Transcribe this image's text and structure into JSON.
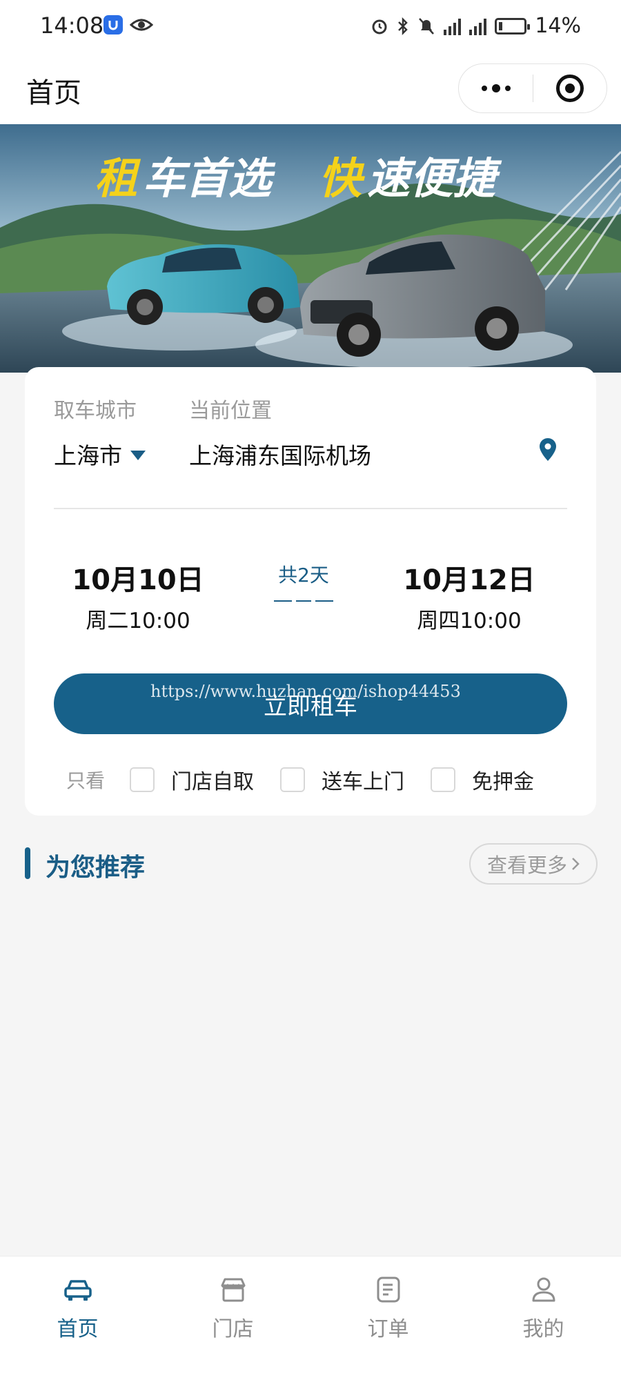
{
  "status_bar": {
    "time": "14:08",
    "battery": "14%",
    "battery_fraction": 0.14
  },
  "nav": {
    "title": "首页",
    "more_icon": "more-dots-icon",
    "close_icon": "target-icon"
  },
  "banner": {
    "headline_part1": "租",
    "headline_part2": "车首选",
    "headline_part3": "快",
    "headline_part4": "速便捷"
  },
  "booking": {
    "city_label": "取车城市",
    "city_value": "上海市",
    "location_label": "当前位置",
    "location_value": "上海浦东国际机场",
    "pickup_date": "10月10日",
    "pickup_time": "周二10:00",
    "duration": "共2天",
    "return_date": "10月12日",
    "return_time": "周四10:00",
    "rent_button": "立即租车",
    "watermark": "https://www.huzhan.com/ishop44453"
  },
  "filters": {
    "label": "只看",
    "options": [
      {
        "label": "门店自取",
        "checked": false
      },
      {
        "label": "送车上门",
        "checked": false
      },
      {
        "label": "免押金",
        "checked": false
      }
    ]
  },
  "recommend": {
    "title": "为您推荐",
    "more": "查看更多"
  },
  "tabs": [
    {
      "label": "首页",
      "icon": "car-icon",
      "active": true
    },
    {
      "label": "门店",
      "icon": "store-icon",
      "active": false
    },
    {
      "label": "订单",
      "icon": "order-icon",
      "active": false
    },
    {
      "label": "我的",
      "icon": "user-icon",
      "active": false
    }
  ],
  "colors": {
    "primary": "#17618a",
    "background": "#f5f5f5",
    "banner_accent": "#f5d21a"
  }
}
